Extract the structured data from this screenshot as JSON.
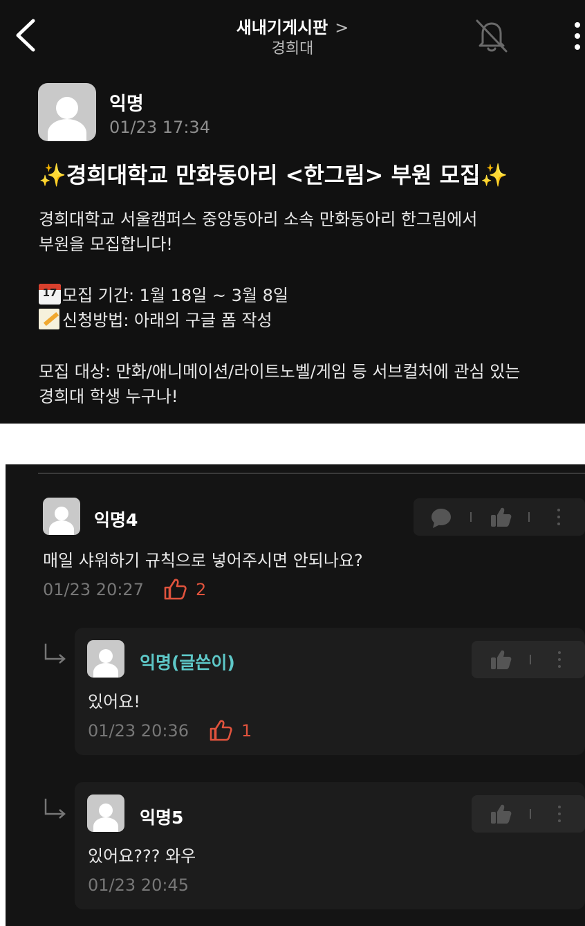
{
  "header": {
    "title": "새내기게시판",
    "chevron": ">",
    "subtitle": "경희대"
  },
  "post": {
    "author": "익명",
    "time": "01/23 17:34",
    "title_spark_left": "✨",
    "title": "경희대학교 만화동아리 <한그림> 부원 모집",
    "title_spark_right": "✨",
    "body_line1": "경희대학교 서울캠퍼스 중앙동아리 소속 만화동아리 한그림에서",
    "body_line2": "부원을 모집합니다!",
    "calendar_day": "17",
    "period": "모집 기간: 1월 18일 ~ 3월 8일",
    "apply": "신청방법: 아래의 구글 폼 작성",
    "target_line1": "모집 대상: 만화/애니메이션/라이트노벨/게임 등 서브컬처에 관심 있는",
    "target_line2": "경희대 학생 누구나!"
  },
  "comments": [
    {
      "author": "익명4",
      "text": "매일 샤워하기 규칙으로 넣어주시면 안되나요?",
      "time": "01/23 20:27",
      "likes": "2",
      "is_reply": false
    },
    {
      "author": "익명(글쓴이)",
      "text": "있어요!",
      "time": "01/23 20:36",
      "likes": "1",
      "is_reply": true,
      "is_op": true
    },
    {
      "author": "익명5",
      "text": "있어요??? 와우",
      "time": "01/23 20:45",
      "is_reply": true
    }
  ],
  "colors": {
    "background": "#111111",
    "op_name": "#5ec8c8",
    "like": "#e0533d",
    "muted": "#8e8e8e"
  },
  "icons": [
    "chevron-left-icon",
    "bell-off-icon",
    "more-vertical-icon",
    "calendar-icon",
    "memo-icon",
    "comment-icon",
    "thumbs-up-icon",
    "reply-arrow-icon"
  ]
}
